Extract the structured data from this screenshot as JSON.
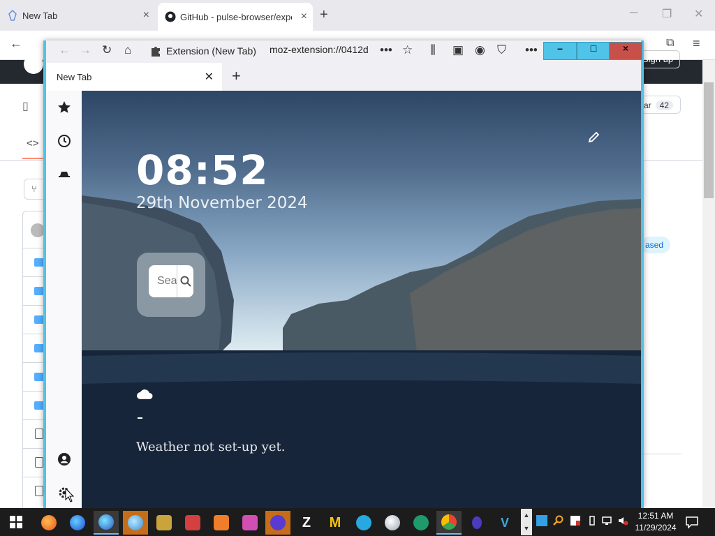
{
  "background_browser": {
    "tabs": [
      {
        "title": "New Tab"
      },
      {
        "title": "GitHub - pulse-browser/experin"
      }
    ],
    "signup_label": "Sign up",
    "star_label": "ar",
    "star_count": "42",
    "tag_label": "ased"
  },
  "firefox": {
    "extension_label": "Extension (New Tab)",
    "url": "moz-extension://0412d",
    "tab_title": "New Tab",
    "window_controls": {
      "minimize": "–",
      "maximize": "□",
      "close": "×"
    }
  },
  "newtab": {
    "clock": "08:52",
    "date": "29th November 2024",
    "search_placeholder": "Search",
    "search_value": "",
    "weather_text": "Weather not set-up yet.",
    "weather_icon": "cloud-icon",
    "sidebar_icons": [
      "star-icon",
      "history-icon",
      "incognito-icon",
      "account-icon",
      "settings-icon"
    ]
  },
  "taskbar": {
    "time": "12:51 AM",
    "date": "11/29/2024",
    "apps": [
      "firefox",
      "firefox-developer",
      "firefox-nightly",
      "firefox-beta",
      "goose-app",
      "vivaldi-red",
      "orange-browser",
      "pink-browser",
      "floorp",
      "zen",
      "m-app",
      "waterfox",
      "white-orb",
      "green-app",
      "chrome-like",
      "bug-app",
      "vs-app"
    ]
  },
  "colors": {
    "window_border": "#4fc3e8",
    "close_button": "#c7504a",
    "taskbar": "#1c1c1c",
    "github_header": "#24292f"
  }
}
